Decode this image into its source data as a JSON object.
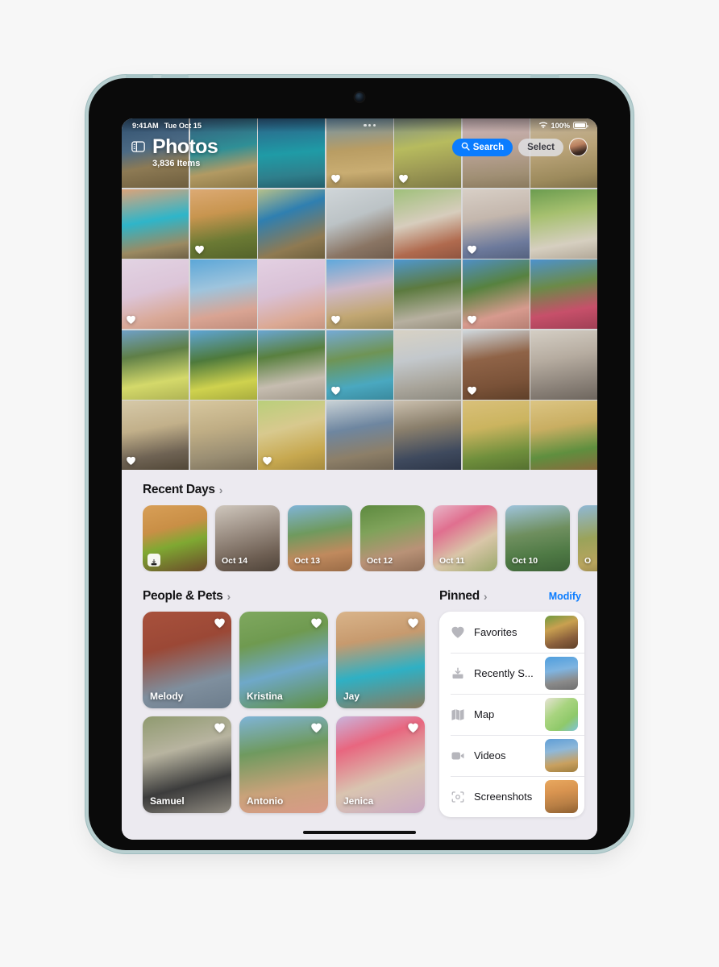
{
  "device": {
    "frame_color": "#b8cfd0",
    "camera": "front-camera"
  },
  "status_bar": {
    "time": "9:41AM",
    "date": "Tue Oct 15",
    "wifi_icon": "wifi-icon",
    "battery_percent": "100%",
    "battery_icon": "battery-full-icon"
  },
  "nav": {
    "sidebar_icon": "sidebar-toggle-icon",
    "title": "Photos",
    "item_count": "3,836 Items",
    "search_label": "Search",
    "search_icon": "search-icon",
    "search_color": "#0a7cff",
    "select_label": "Select",
    "avatar": "user-avatar"
  },
  "photo_grid": {
    "columns": 7,
    "rows": 5,
    "cells": [
      {
        "c": "linear-gradient(170deg,#2f4f6e 0%,#4c6a84 42%,#8d7a54 66%,#6e5e3e 100%)",
        "fav": false
      },
      {
        "c": "linear-gradient(170deg,#35597a 0%,#2f8f96 45%,#b29a63 72%,#8c7846 100%)",
        "fav": false
      },
      {
        "c": "linear-gradient(175deg,#2e5e86 0%,#1f9ba6 50%,#2f7f8c 80%,#245e6b 100%)",
        "fav": false
      },
      {
        "c": "linear-gradient(175deg,#6f94ad 0%,#b99d63 45%,#c9ad72 75%,#9c8350 100%)",
        "fav": true
      },
      {
        "c": "linear-gradient(170deg,#7e8f86 0%,#b7bb5e 40%,#9d9a55 70%,#7e7a45 100%)",
        "fav": true
      },
      {
        "c": "linear-gradient(175deg,#cdb6bb 0%,#b9a295 45%,#a08f74 80%,#8a7a5e 100%)",
        "fav": false
      },
      {
        "c": "linear-gradient(170deg,#c6b79f 0%,#b9a378 45%,#9c8a5c 80%,#7e6f49 100%)",
        "fav": false
      },
      {
        "c": "linear-gradient(170deg,#dba37a 0%,#2fb5c9 45%,#9b8a62 80%,#6f6146 100%)",
        "fav": false
      },
      {
        "c": "linear-gradient(170deg,#dcaa74 0%,#c8954f 35%,#6b7a34 70%,#54632b 100%)",
        "fav": true
      },
      {
        "c": "linear-gradient(160deg,#b6c08a 0%,#2f7fb0 35%,#8f7a52 75%,#6d5f3d 100%)",
        "fav": false
      },
      {
        "c": "linear-gradient(160deg,#cfd5d8 0%,#bcc3c6 40%,#8a7564 75%,#6f5d4e 100%)",
        "fav": false
      },
      {
        "c": "linear-gradient(165deg,#9fc07a 0%,#d7cdbd 45%,#b06a4e 78%,#8f5540 100%)",
        "fav": false
      },
      {
        "c": "linear-gradient(170deg,#d8cfc6 0%,#c4b7ad 40%,#6d7a9c 78%,#55627f 100%)",
        "fav": true
      },
      {
        "c": "linear-gradient(170deg,#6b9c4f 0%,#a6c06f 35%,#d6cfc0 75%,#b2a898 100%)",
        "fav": false
      },
      {
        "c": "linear-gradient(165deg,#e2d3e3 0%,#dcc5d8 45%,#d9a998 78%,#c89582 100%)",
        "fav": true
      },
      {
        "c": "linear-gradient(170deg,#5ca7d8 0%,#9ec4dd 40%,#d9a493 75%,#c08d7c 100%)",
        "fav": false
      },
      {
        "c": "linear-gradient(165deg,#e3d0e2 0%,#d9c1d6 45%,#dba994 80%,#c59580 100%)",
        "fav": false
      },
      {
        "c": "linear-gradient(170deg,#5ea8dc 0%,#cfb9c9 40%,#c2a773 75%,#9d8a58 100%)",
        "fav": true
      },
      {
        "c": "linear-gradient(170deg,#4f97cf 0%,#5c7a3f 40%,#b7b0a0 78%,#968f7e 100%)",
        "fav": false
      },
      {
        "c": "linear-gradient(165deg,#4f8fc6 0%,#57823f 38%,#d79a8e 75%,#b67f73 100%)",
        "fav": true
      },
      {
        "c": "linear-gradient(170deg,#4d92cd 0%,#6b8a48 38%,#c7506a 72%,#a03f55 100%)",
        "fav": false
      },
      {
        "c": "linear-gradient(170deg,#6fa0c7 0%,#5f7f47 35%,#d4d96a 72%,#b0b455 100%)",
        "fav": false
      },
      {
        "c": "linear-gradient(170deg,#5fa5d6 0%,#4e7a3c 40%,#cfd24e 75%,#a9ad3f 100%)",
        "fav": false
      },
      {
        "c": "linear-gradient(170deg,#6aa6d2 0%,#59803f 35%,#c6bdb0 72%,#a39a8c 100%)",
        "fav": false
      },
      {
        "c": "linear-gradient(170deg,#74aad6 0%,#6f9455 38%,#4aa8c0 75%,#3a8a9e 100%)",
        "fav": true
      },
      {
        "c": "linear-gradient(170deg,#d8d2c4 0%,#c3c8cc 40%,#a8a49a 75%,#8d8a80 100%)",
        "fav": false
      },
      {
        "c": "linear-gradient(170deg,#cfd8dd 0%,#8f6347 40%,#7a5238 75%,#5f4029 100%)",
        "fav": true
      },
      {
        "c": "linear-gradient(170deg,#d4cec4 0%,#b6aca0 40%,#8b8279 75%,#6e665e 100%)",
        "fav": false
      },
      {
        "c": "linear-gradient(170deg,#d6c9a8 0%,#c2b08a 40%,#6f6354 75%,#514737 100%)",
        "fav": true
      },
      {
        "c": "linear-gradient(170deg,#d7c79e 0%,#c0ae85 40%,#9a8e73 75%,#7b705a 100%)",
        "fav": false
      },
      {
        "c": "linear-gradient(165deg,#b9cf7a 0%,#d8c98e 40%,#c7a84f 75%,#a58a3f 100%)",
        "fav": true
      },
      {
        "c": "linear-gradient(170deg,#c9d2d6 0%,#6e86a0 40%,#8d7f68 75%,#6e6352 100%)",
        "fav": false
      },
      {
        "c": "linear-gradient(170deg,#cbc0ae 0%,#8a7f6c 38%,#3f4a5e 75%,#2d3648 100%)",
        "fav": false
      },
      {
        "c": "linear-gradient(170deg,#d9c07a 0%,#cbb45f 38%,#6f8f3c 75%,#557030 100%)",
        "fav": false
      },
      {
        "c": "linear-gradient(170deg,#dcc583 0%,#c9ae62 38%,#5f8f3f 72%,#8a6a3c 100%)",
        "fav": false
      }
    ]
  },
  "recent_days": {
    "title": "Recent Days",
    "chevron": "chevron-right-icon",
    "cards": [
      {
        "label": "",
        "badge": "save-to-library-icon",
        "c": "linear-gradient(165deg,#d89f57 0%,#c98f46 35%,#7fa832 58%,#6b4a2a 100%)"
      },
      {
        "label": "Oct 14",
        "badge": "",
        "c": "linear-gradient(165deg,#cfc7bd 0%,#9c8f84 40%,#6e5f53 75%,#4e4339 100%)"
      },
      {
        "label": "Oct 13",
        "badge": "",
        "c": "linear-gradient(170deg,#7fb4d8 0%,#6f9a5e 40%,#c08a5e 72%,#9a6c47 100%)"
      },
      {
        "label": "Oct 12",
        "badge": "",
        "c": "linear-gradient(165deg,#5d8a3f 0%,#7fa25a 35%,#b99277 70%,#8e6d56 100%)"
      },
      {
        "label": "Oct 11",
        "badge": "",
        "c": "linear-gradient(150deg,#e8b6c8 0%,#e06f8f 30%,#d9c6a8 62%,#9aa86b 100%)"
      },
      {
        "label": "Oct 10",
        "badge": "",
        "c": "linear-gradient(170deg,#9fc4dd 0%,#6f8f5f 42%,#4f7a45 72%,#3d6237 100%)"
      },
      {
        "label": "O",
        "badge": "",
        "c": "linear-gradient(170deg,#8fb8d6 0%,#9aa35a 45%,#b8a45e 78%,#8f7f45 100%)"
      }
    ]
  },
  "people_pets": {
    "title": "People & Pets",
    "chevron": "chevron-right-icon",
    "people": [
      {
        "name": "Melody",
        "c": "linear-gradient(165deg,#a8513c 0%,#9b4836 35%,#7f8f9e 72%,#6d7d8c 100%)"
      },
      {
        "name": "Kristina",
        "c": "linear-gradient(165deg,#7fa85f 0%,#6f9a50 30%,#6fa8c9 60%,#5f8f3f 100%)"
      },
      {
        "name": "Jay",
        "c": "linear-gradient(170deg,#d9b48a 0%,#c79a6e 30%,#2fb0c4 62%,#8a7a5e 100%)"
      },
      {
        "name": "Samuel",
        "c": "linear-gradient(165deg,#8f9a6f 0%,#b8b4a0 35%,#3c3c3c 68%,#8f8a80 100%)"
      },
      {
        "name": "Antonio",
        "c": "linear-gradient(170deg,#7fb4d8 0%,#6f9a5f 35%,#c9a27a 72%,#d99a88 100%)"
      },
      {
        "name": "Jenica",
        "c": "linear-gradient(160deg,#c9b4dc 0%,#e8667f 28%,#d9c4b0 62%,#c9a8c4 100%)"
      }
    ]
  },
  "pinned": {
    "title": "Pinned",
    "chevron": "chevron-right-icon",
    "modify_label": "Modify",
    "modify_color": "#0a7cff",
    "items": [
      {
        "label": "Favorites",
        "icon": "heart-icon",
        "c": "linear-gradient(160deg,#6f9a3f 0%,#c9a050 35%,#8a5f3c 70%,#5f4028 100%)"
      },
      {
        "label": "Recently S...",
        "icon": "recently-saved-icon",
        "c": "linear-gradient(170deg,#4f9ede 0%,#7fb4e0 40%,#8a8a8a 72%,#6f6f6f 100%)"
      },
      {
        "label": "Map",
        "icon": "map-icon",
        "c": "linear-gradient(140deg,#e8e4d6 0%,#a8d47f 40%,#8fc96a 70%,#7fc4d9 100%)"
      },
      {
        "label": "Videos",
        "icon": "video-camera-icon",
        "c": "linear-gradient(170deg,#5f9ed6 0%,#8fb8d9 35%,#c9a05f 72%,#a07f40 100%)"
      },
      {
        "label": "Screenshots",
        "icon": "screenshot-icon",
        "c": "linear-gradient(170deg,#e8a85f 0%,#d99450 35%,#b87f45 70%,#8f6030 100%)"
      }
    ]
  },
  "home_indicator": "home-indicator"
}
